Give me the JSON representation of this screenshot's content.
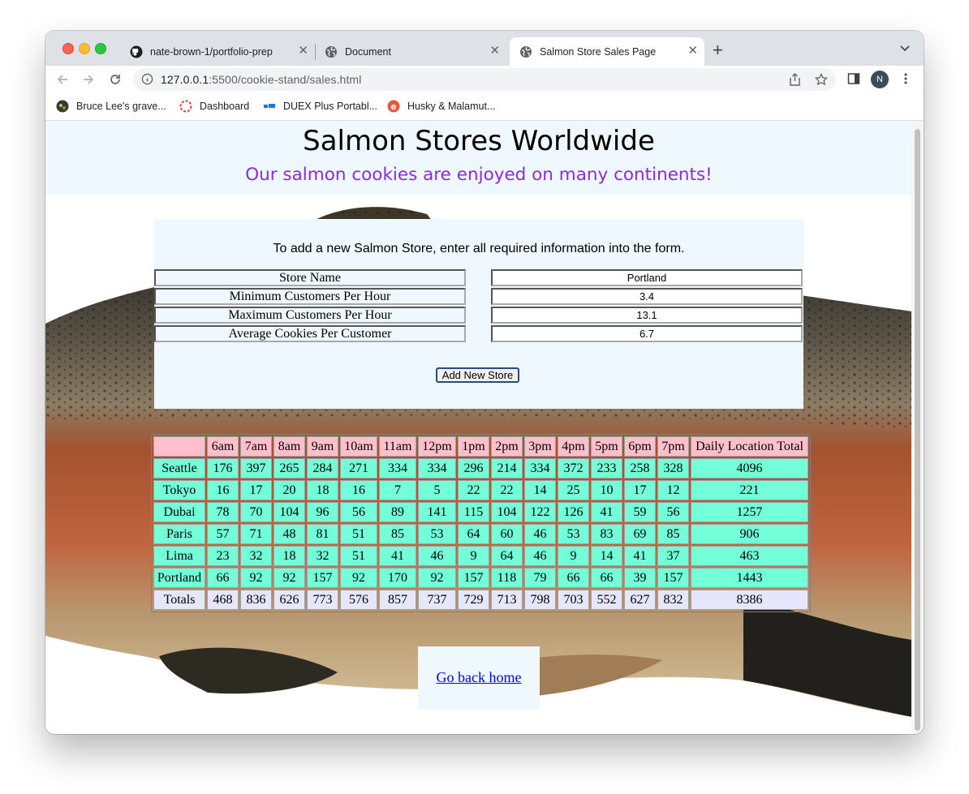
{
  "browser": {
    "tabs": [
      {
        "title": "nate-brown-1/portfolio-prep",
        "icon": "github-icon",
        "active": false
      },
      {
        "title": "Document",
        "icon": "globe-icon",
        "active": false
      },
      {
        "title": "Salmon Store Sales Page",
        "icon": "globe-icon",
        "active": true
      }
    ],
    "url_host": "127.0.0.1",
    "url_path": ":5500/cookie-stand/sales.html",
    "profile_initial": "N",
    "bookmarks": [
      {
        "label": "Bruce Lee's grave...",
        "icon": "bookmark-favicon-icon"
      },
      {
        "label": "Dashboard",
        "icon": "dashboard-favicon-icon"
      },
      {
        "label": "DUEX Plus Portabl...",
        "icon": "duex-favicon-icon"
      },
      {
        "label": "Husky & Malamut...",
        "icon": "husky-favicon-icon"
      }
    ]
  },
  "page": {
    "title": "Salmon Stores Worldwide",
    "subtitle": "Our salmon cookies are enjoyed on many continents!",
    "title_color": "#000000",
    "subtitle_color": "#8a2be2"
  },
  "form": {
    "note": "To add a new Salmon Store, enter all required information into the form.",
    "fields": [
      {
        "label": "Store Name",
        "value": "Portland"
      },
      {
        "label": "Minimum Customers Per Hour",
        "value": "3.4"
      },
      {
        "label": "Maximum Customers Per Hour",
        "value": "13.1"
      },
      {
        "label": "Average Cookies Per Customer",
        "value": "6.7"
      }
    ],
    "submit_label": "Add New Store"
  },
  "sales_table": {
    "headers": [
      "",
      "6am",
      "7am",
      "8am",
      "9am",
      "10am",
      "11am",
      "12pm",
      "1pm",
      "2pm",
      "3pm",
      "4pm",
      "5pm",
      "6pm",
      "7pm",
      "Daily Location Total"
    ],
    "rows": [
      [
        "Seattle",
        "176",
        "397",
        "265",
        "284",
        "271",
        "334",
        "334",
        "296",
        "214",
        "334",
        "372",
        "233",
        "258",
        "328",
        "4096"
      ],
      [
        "Tokyo",
        "16",
        "17",
        "20",
        "18",
        "16",
        "7",
        "5",
        "22",
        "22",
        "14",
        "25",
        "10",
        "17",
        "12",
        "221"
      ],
      [
        "Dubai",
        "78",
        "70",
        "104",
        "96",
        "56",
        "89",
        "141",
        "115",
        "104",
        "122",
        "126",
        "41",
        "59",
        "56",
        "1257"
      ],
      [
        "Paris",
        "57",
        "71",
        "48",
        "81",
        "51",
        "85",
        "53",
        "64",
        "60",
        "46",
        "53",
        "83",
        "69",
        "85",
        "906"
      ],
      [
        "Lima",
        "23",
        "32",
        "18",
        "32",
        "51",
        "41",
        "46",
        "9",
        "64",
        "46",
        "9",
        "14",
        "41",
        "37",
        "463"
      ],
      [
        "Portland",
        "66",
        "92",
        "92",
        "157",
        "92",
        "170",
        "92",
        "157",
        "118",
        "79",
        "66",
        "66",
        "39",
        "157",
        "1443"
      ]
    ],
    "totals": [
      "Totals",
      "468",
      "836",
      "626",
      "773",
      "576",
      "857",
      "737",
      "729",
      "713",
      "798",
      "703",
      "552",
      "627",
      "832",
      "8386"
    ],
    "colors": {
      "header": "#ffc0cb",
      "cell": "#73ffd8",
      "totals": "#e6e6fa"
    }
  },
  "footer": {
    "home_link": "Go back home"
  }
}
